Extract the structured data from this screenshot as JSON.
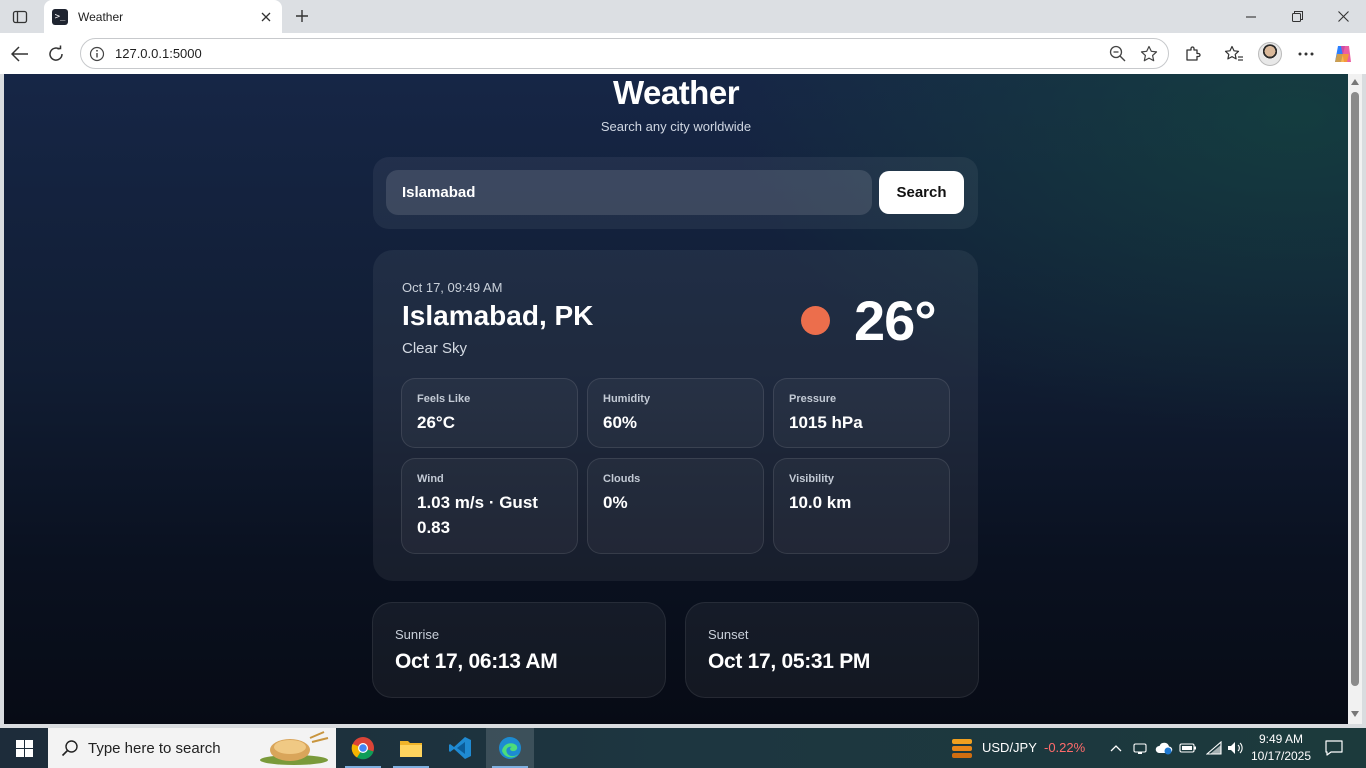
{
  "browser": {
    "tab_title": "Weather",
    "url": "127.0.0.1:5000"
  },
  "page": {
    "title": "Weather",
    "subtitle": "Search any city worldwide"
  },
  "search": {
    "value": "Islamabad",
    "button_label": "Search"
  },
  "current": {
    "datetime": "Oct 17, 09:49 AM",
    "city": "Islamabad, PK",
    "description": "Clear Sky",
    "temperature": "26°",
    "icon": "sun-icon",
    "icon_color": "#ec6e4c"
  },
  "metrics": [
    {
      "label": "Feels Like",
      "value": "26°C"
    },
    {
      "label": "Humidity",
      "value": "60%"
    },
    {
      "label": "Pressure",
      "value": "1015 hPa"
    },
    {
      "label": "Wind",
      "value": "1.03 m/s · Gust 0.83"
    },
    {
      "label": "Clouds",
      "value": "0%"
    },
    {
      "label": "Visibility",
      "value": "10.0 km"
    }
  ],
  "sun": {
    "sunrise_label": "Sunrise",
    "sunrise_value": "Oct 17, 06:13 AM",
    "sunset_label": "Sunset",
    "sunset_value": "Oct 17, 05:31 PM"
  },
  "taskbar": {
    "search_placeholder": "Type here to search",
    "ticker_name": "USD/JPY",
    "ticker_change": "-0.22%",
    "ticker_change_color": "#ff6b6b",
    "time": "9:49 AM",
    "date": "10/17/2025"
  }
}
